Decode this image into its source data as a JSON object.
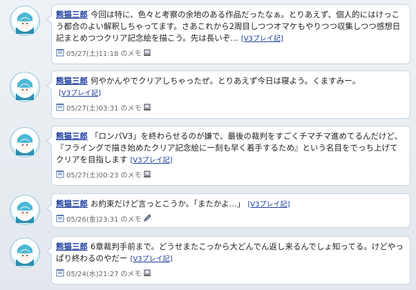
{
  "posts": [
    {
      "author": "熊猫三郎",
      "body": "今回は特に、色々と考察の余地のある作品だったなぁ。とりあえず、個人的にはけっこう都合のよい解釈しちゃってます。さあこれから2周目しつつオマケもやりつつ収集しつつ感想日記まとめつつクリア記念絵を描こう。先は長いぞ…",
      "tag_open": "[",
      "tag": "V3プレイ記",
      "tag_close": "]",
      "timestamp": "05/27(土)11:18",
      "memo": "のメモ",
      "device_icon": "pc-icon"
    },
    {
      "author": "熊猫三郎",
      "body": "何やかんやでクリアしちゃったぜ。とりあえず今日は寝よう。くますみー。",
      "tag_open": "[",
      "tag": "V3プレイ記",
      "tag_close": "]",
      "timestamp": "05/27(土)03:31",
      "memo": "のメモ",
      "device_icon": "pc-icon"
    },
    {
      "author": "熊猫三郎",
      "body": "「ロンパV3」を終わらせるのが嫌で、最後の裁判をすごくチマチマ進めてるんだけど、『フライングで描き始めたクリア記念絵に一刻も早く着手するため』という名目をでっち上げてクリアを目指します",
      "tag_open": "[",
      "tag": "V3プレイ記",
      "tag_close": "]",
      "timestamp": "05/27(土)00:23",
      "memo": "のメモ",
      "device_icon": "pc-icon"
    },
    {
      "author": "熊猫三郎",
      "body": "お約束だけど言っとこうか。「またかよ…」",
      "tag_open": "[",
      "tag": "V3プレイ記",
      "tag_close": "]",
      "timestamp": "05/26(金)23:31",
      "memo": "のメモ",
      "device_icon": "pen-icon"
    },
    {
      "author": "熊猫三郎",
      "body": "6章裁判手前まで。どうせまたこっから大どんでん返し来るんでしょ知ってる。けどやっぱり終わるのやだー",
      "tag_open": "[",
      "tag": "V3プレイ記",
      "tag_close": "]",
      "timestamp": "05/24(水)21:27",
      "memo": "のメモ",
      "device_icon": "pc-icon"
    }
  ],
  "colors": {
    "link": "#1a3a9a",
    "bubble_border": "#c9d3de",
    "background": "#e4e9ef"
  }
}
